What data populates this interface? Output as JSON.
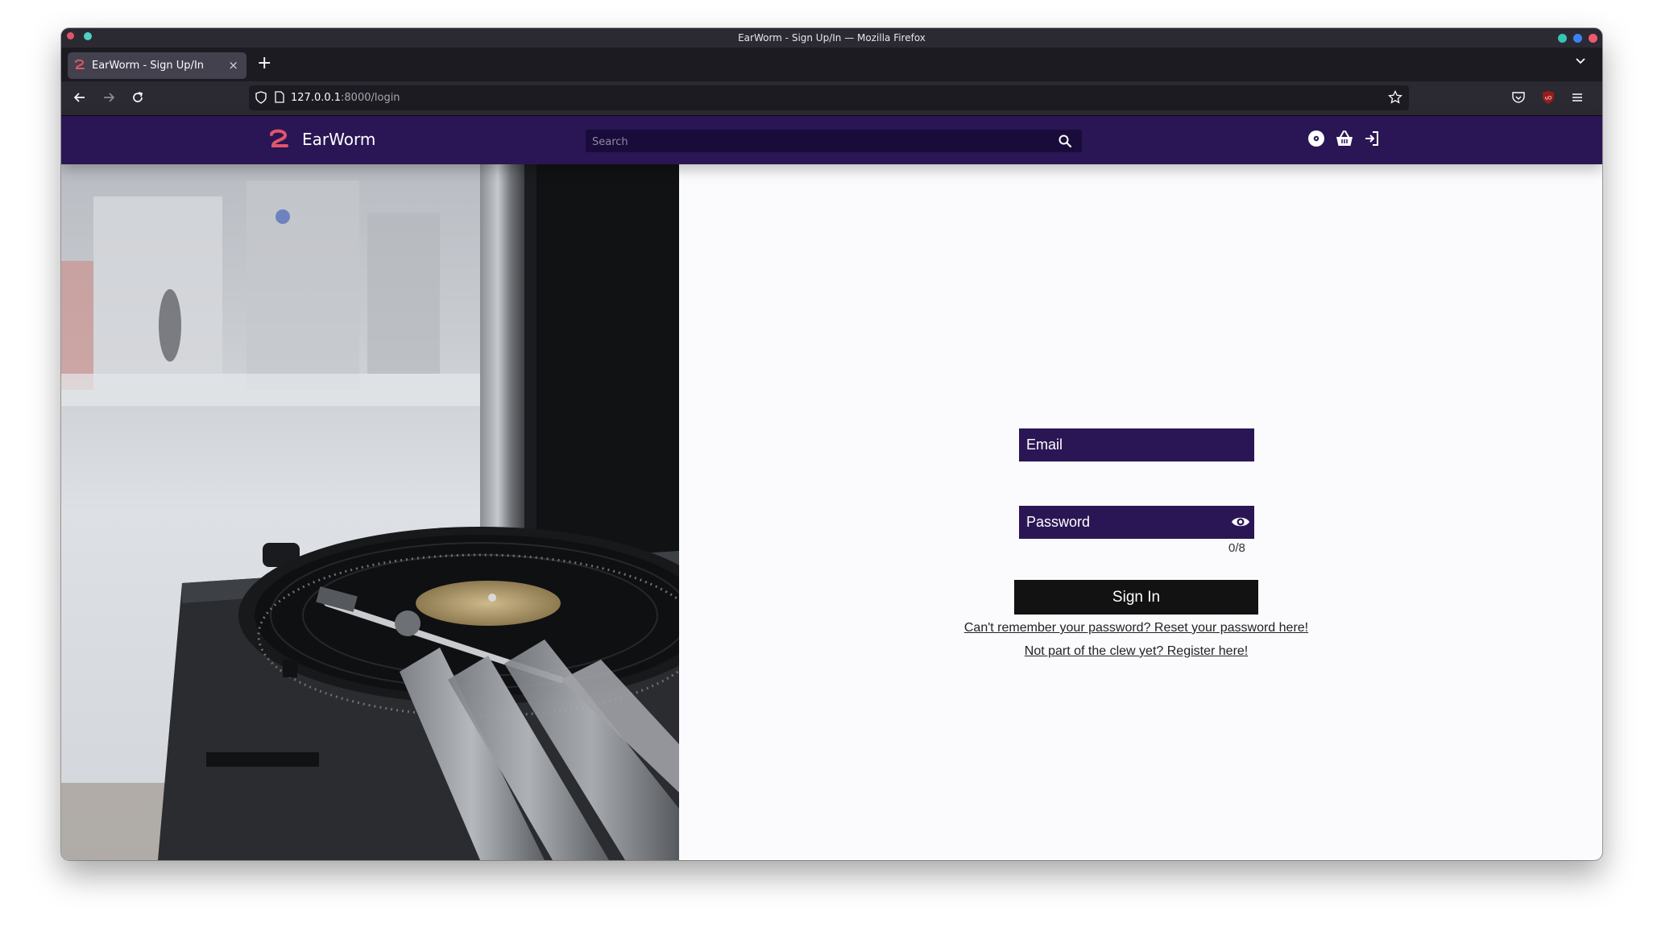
{
  "browser": {
    "window_title": "EarWorm - Sign Up/In — Mozilla Firefox",
    "tab_title": "EarWorm - Sign Up/In",
    "tab_close": "×",
    "new_tab": "+",
    "url_host": "127.0.0.1",
    "url_path": ":8000/login"
  },
  "site": {
    "brand": "EarWorm",
    "search_placeholder": "Search"
  },
  "form": {
    "email_placeholder": "Email",
    "password_placeholder": "Password",
    "password_counter": "0/8",
    "signin_label": "Sign In",
    "reset_link": "Can't remember your password? Reset your password here!",
    "register_link": "Not part of the clew yet? Register here!"
  },
  "colors": {
    "header": "#2a1654",
    "field": "#2a1654",
    "button": "#121212",
    "brand_accent": "#e0556b"
  }
}
